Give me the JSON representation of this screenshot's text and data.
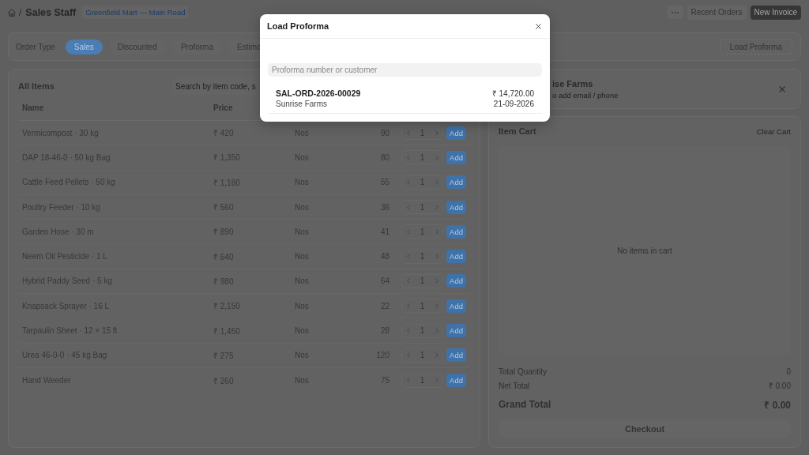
{
  "topbar": {
    "separator": "/",
    "title": "Sales Staff",
    "store_badge": "Greenfield Mart — Main Road",
    "buttons": [
      {
        "label": "Recent Orders",
        "kind": "secondary"
      },
      {
        "label": "New Invoice",
        "kind": "primary"
      }
    ]
  },
  "order_type": {
    "label": "Order Type",
    "tabs": [
      {
        "label": "Sales",
        "selected": true
      },
      {
        "label": "Discounted",
        "selected": false
      },
      {
        "label": "Proforma",
        "selected": false
      },
      {
        "label": "Estima",
        "selected": false
      }
    ],
    "action": "Load Proforma"
  },
  "items_panel": {
    "title": "All Items",
    "search": {
      "placeholder": "Search by item code, s"
    },
    "columns": [
      "Name",
      "Price"
    ],
    "rows": [
      {
        "name": "Vermicompost · 30 kg",
        "price": "₹ 420",
        "uom": "Nos",
        "stock": "90",
        "quantity": "1",
        "action": "Add"
      },
      {
        "name": "DAP 18-46-0 · 50 kg Bag",
        "price": "₹ 1,350",
        "uom": "Nos",
        "stock": "80",
        "quantity": "1",
        "action": "Add"
      },
      {
        "name": "Cattle Feed Pellets · 50 kg",
        "price": "₹ 1,180",
        "uom": "Nos",
        "stock": "55",
        "quantity": "1",
        "action": "Add"
      },
      {
        "name": "Poultry Feeder · 10 kg",
        "price": "₹ 560",
        "uom": "Nos",
        "stock": "36",
        "quantity": "1",
        "action": "Add"
      },
      {
        "name": "Garden Hose · 30 m",
        "price": "₹ 890",
        "uom": "Nos",
        "stock": "41",
        "quantity": "1",
        "action": "Add"
      },
      {
        "name": "Neem Oil Pesticide · 1 L",
        "price": "₹ 640",
        "uom": "Nos",
        "stock": "48",
        "quantity": "1",
        "action": "Add"
      },
      {
        "name": "Hybrid Paddy Seed · 5 kg",
        "price": "₹ 980",
        "uom": "Nos",
        "stock": "64",
        "quantity": "1",
        "action": "Add"
      },
      {
        "name": "Knapsack Sprayer · 16 L",
        "price": "₹ 2,150",
        "uom": "Nos",
        "stock": "22",
        "quantity": "1",
        "action": "Add"
      },
      {
        "name": "Tarpaulin Sheet · 12 × 15 ft",
        "price": "₹ 1,450",
        "uom": "Nos",
        "stock": "28",
        "quantity": "1",
        "action": "Add"
      },
      {
        "name": "Urea 46-0-0 · 45 kg Bag",
        "price": "₹ 275",
        "uom": "Nos",
        "stock": "120",
        "quantity": "1",
        "action": "Add"
      },
      {
        "name": "Hand Weeder",
        "price": "₹ 260",
        "uom": "Nos",
        "stock": "75",
        "quantity": "1",
        "action": "Add"
      }
    ]
  },
  "customer": {
    "name": "ise Farms",
    "hint": "o add email / phone"
  },
  "cart": {
    "title": "Item Cart",
    "clear": "Clear Cart",
    "empty_text": "No items in cart",
    "totals": [
      {
        "label": "Total Quantity",
        "value": "0",
        "kind": "normal"
      },
      {
        "label": "Net Total",
        "value": "₹ 0.00",
        "kind": "normal"
      },
      {
        "label": "Grand Total",
        "value": "₹ 0.00",
        "kind": "grand"
      }
    ],
    "checkout": "Checkout"
  },
  "dialog": {
    "title": "Load Proforma",
    "search": {
      "placeholder": "Proforma number or customer"
    },
    "results": [
      {
        "number": "SAL-ORD-2026-00029",
        "customer": "Sunrise Farms",
        "amount": "₹ 14,720.00",
        "date": "21-09-2026"
      }
    ]
  }
}
